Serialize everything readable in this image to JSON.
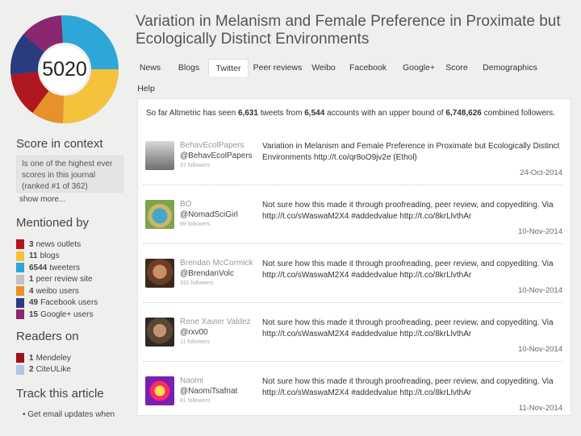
{
  "score": "5020",
  "article_title": "Variation in Melanism and Female Preference in Proximate but Ecologically Distinct Environments",
  "tabs": [
    {
      "label": "News",
      "active": false
    },
    {
      "label": "Blogs",
      "active": false
    },
    {
      "label": "Twitter",
      "active": true
    },
    {
      "label": "Peer reviews",
      "active": false
    },
    {
      "label": "Weibo",
      "active": false
    },
    {
      "label": "Facebook",
      "active": false
    },
    {
      "label": "Google+",
      "active": false
    },
    {
      "label": "Score",
      "active": false
    },
    {
      "label": "Demographics",
      "active": false
    },
    {
      "label": "Help",
      "active": false
    }
  ],
  "sidebar": {
    "score_context_heading": "Score in context",
    "score_context_text": "Is one of the highest ever scores in this journal (ranked #1 of 362)",
    "show_more": "show more...",
    "mentioned_heading": "Mentioned by",
    "mentions": [
      {
        "count": "3",
        "label": "news outlets",
        "color": "#b0171f"
      },
      {
        "count": "11",
        "label": "blogs",
        "color": "#f6c23b"
      },
      {
        "count": "6544",
        "label": "tweeters",
        "color": "#2ea7d8"
      },
      {
        "count": "1",
        "label": "peer review site",
        "color": "#c3c3c3"
      },
      {
        "count": "4",
        "label": "weibo users",
        "color": "#e8902a"
      },
      {
        "count": "49",
        "label": "Facebook users",
        "color": "#2b3b80"
      },
      {
        "count": "15",
        "label": "Google+ users",
        "color": "#8b2670"
      }
    ],
    "readers_heading": "Readers on",
    "readers": [
      {
        "count": "1",
        "label": "Mendeley",
        "color": "#a01018"
      },
      {
        "count": "2",
        "label": "CiteULike",
        "color": "#b8c4e4"
      }
    ],
    "track_heading": "Track this article",
    "track_item": "Get email updates when"
  },
  "summary": {
    "prefix": "So far Altmetric has seen ",
    "tweets": "6,631",
    "mid1": " tweets from ",
    "accounts": "6,544",
    "mid2": " accounts with an upper bound of ",
    "followers": "6,748,626",
    "suffix": " combined followers."
  },
  "tweets": [
    {
      "name": "BehavEcolPapers",
      "handle": "@BehavEcolPapers",
      "followers": "37 followers",
      "text": "Variation in Melanism and Female Preference in Proximate but Ecologically Distinct Environments http://t.co/qr8oO9jv2e (Ethol)",
      "date": "24-Oct-2014"
    },
    {
      "name": "BO",
      "handle": "@NomadSciGirl",
      "followers": "89 followers",
      "text": "Not sure how this made it through proofreading, peer review, and copyediting. Via http://t.co/sWaswaM2X4 #addedvalue http://t.co/8krLlvthAr",
      "date": "10-Nov-2014"
    },
    {
      "name": "Brendan McCormick",
      "handle": "@BrendanVolc",
      "followers": "331 followers",
      "text": "Not sure how this made it through proofreading, peer review, and copyediting. Via http://t.co/sWaswaM2X4 #addedvalue http://t.co/8krLlvthAr",
      "date": "10-Nov-2014"
    },
    {
      "name": "Rene Xavier Valdez",
      "handle": "@rxv00",
      "followers": "11 followers",
      "text": "Not sure how this made it through proofreading, peer review, and copyediting. Via http://t.co/sWaswaM2X4 #addedvalue http://t.co/8krLlvthAr",
      "date": "10-Nov-2014"
    },
    {
      "name": "Naomi",
      "handle": "@NaomiTsafnat",
      "followers": "81 followers",
      "text": "Not sure how this made it through proofreading, peer review, and copyediting. Via http://t.co/sWaswaM2X4 #addedvalue http://t.co/8krLlvthAr",
      "date": "11-Nov-2014"
    }
  ]
}
